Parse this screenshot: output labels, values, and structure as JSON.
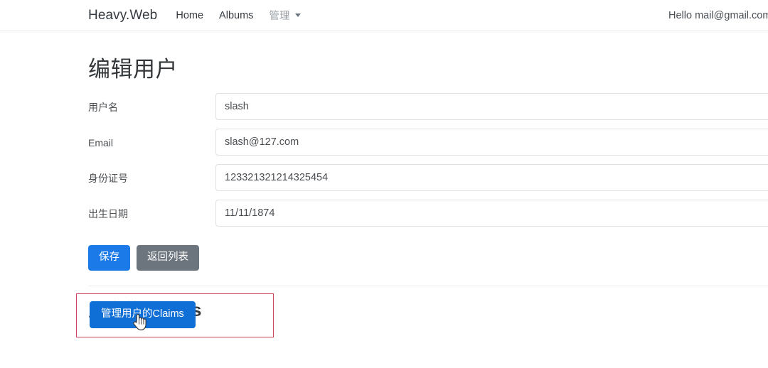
{
  "navbar": {
    "brand": "Heavy.Web",
    "links": [
      {
        "label": "Home",
        "muted": false
      },
      {
        "label": "Albums",
        "muted": false
      },
      {
        "label": "管理",
        "muted": true,
        "has_caret": true
      }
    ],
    "user_greeting": "Hello mail@gmail.com",
    "caret_icon": "chevron-down-icon"
  },
  "page": {
    "title": "编辑用户"
  },
  "form": {
    "fields": [
      {
        "label": "用户名",
        "value": "slash",
        "name": "username"
      },
      {
        "label": "Email",
        "value": "slash@127.com",
        "name": "email"
      },
      {
        "label": "身份证号",
        "value": "123321321214325454",
        "name": "id-number"
      },
      {
        "label": "出生日期",
        "value": "11/11/1874",
        "name": "birth-date"
      }
    ],
    "save_label": "保存",
    "back_label": "返回列表"
  },
  "claims": {
    "section_title_cn": "用户的",
    "section_title_latin": "Claims",
    "manage_button_label": "管理用户的Claims"
  },
  "colors": {
    "primary": "#1b7ae8",
    "claims_primary": "#0f6fd6",
    "secondary": "#6c757d",
    "highlight_border": "#c9485c",
    "text": "#33373a",
    "border": "#dfe2e5"
  },
  "cursor": {
    "icon": "pointing-hand-cursor"
  }
}
